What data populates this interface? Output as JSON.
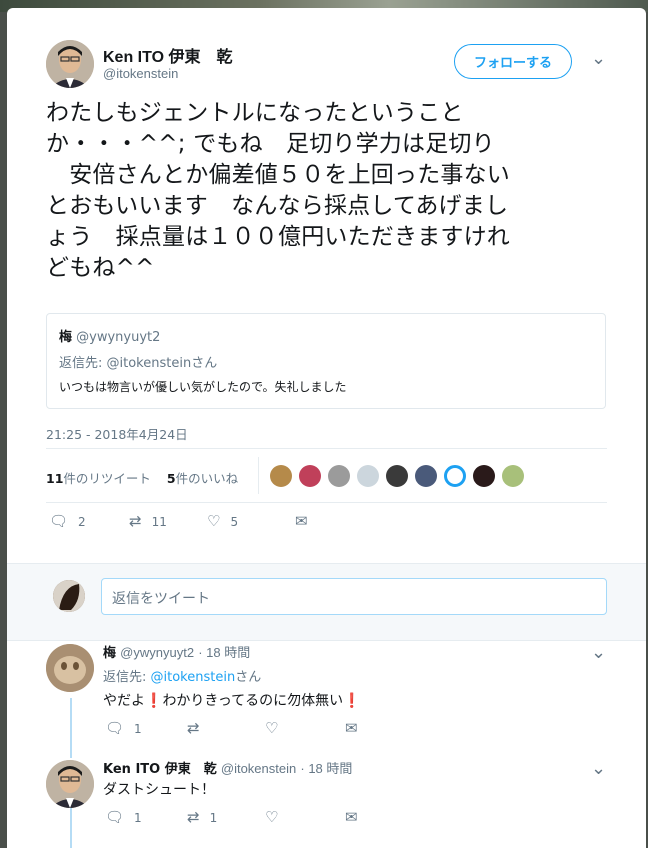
{
  "tweet": {
    "author_name": "Ken ITO 伊東　乾",
    "author_handle": "@itokenstein",
    "follow_label": "フォローする",
    "caret": "⌄",
    "text": "わたしもジェントルになったということ\nか・・・^^; でもね　足切り学力は足切り\n　安倍さんとか偏差値５０を上回った事ない\nとおもいいます　なんなら採点してあげまし\nょう　採点量は１００億円いただきますけれ\nどもね^^",
    "quote": {
      "name": "梅",
      "handle": "@ywynyuyt2",
      "reply_to": "返信先: @itokensteinさん",
      "text": "いつもは物言いが優しい気がしたので。失礼しました"
    },
    "timestamp": "21:25 - 2018年4月24日",
    "stats": {
      "retweets_count": "11",
      "retweets_label": "件のリツイート",
      "likes_count": "5",
      "likes_label": "件のいいね"
    },
    "actions": {
      "reply_count": "2",
      "retweet_count": "11",
      "like_count": "5"
    }
  },
  "reply_box": {
    "placeholder": "返信をツイート"
  },
  "replies": [
    {
      "name": "梅",
      "handle": "@ywynyuyt2",
      "time": "· 18 時間",
      "reply_prefix": "返信先: ",
      "reply_link": "@itokenstein",
      "reply_suffix": "さん",
      "text_before": "やだよ",
      "text_middle": "わかりきってるのに勿体無い",
      "mark": "❗",
      "reply_count": "1",
      "retweet_count": "",
      "like_count": ""
    },
    {
      "name": "Ken ITO 伊東　乾",
      "handle": "@itokenstein",
      "time": "· 18 時間",
      "text": "ダストシュート！",
      "reply_count": "1",
      "retweet_count": "1",
      "like_count": ""
    }
  ],
  "colors": {
    "accent": "#1da1f2",
    "text": "#14171a",
    "secondary": "#657786",
    "thread_line": "#b5dcf5"
  }
}
